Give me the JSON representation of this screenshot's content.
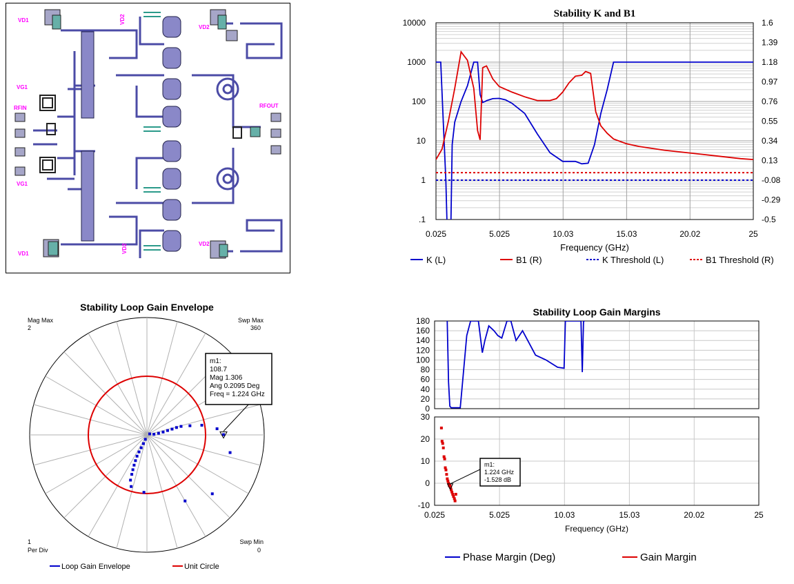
{
  "layout_panel": {
    "labels": {
      "vd1_top": "VD1",
      "vd2_top_mid": "VD2",
      "vd2_top_right": "VD2",
      "vg1_mid": "VG1",
      "rfin": "RFIN",
      "rfout": "RFOUT",
      "vg1_bot": "VG1",
      "vd1_bot": "VD1",
      "vd2_bot_mid": "VD2",
      "vd2_bot_right": "VD2"
    }
  },
  "colors": {
    "blue": "#0000cc",
    "red": "#dd0000",
    "grid": "#c8c8c8",
    "layout_bg": "#ffffff",
    "metal": "#5a5aa8",
    "label": "#ff00ff"
  },
  "chart_data": [
    {
      "type": "line",
      "title": "Stability K and B1",
      "xlabel": "Frequency (GHz)",
      "x_ticks": [
        "0.025",
        "5.025",
        "10.03",
        "15.03",
        "20.02",
        "25"
      ],
      "xlim": [
        0.025,
        25
      ],
      "y_left_ticks": [
        "10000",
        "1000",
        "100",
        "10",
        "1",
        ".1"
      ],
      "y_left_scale": "log",
      "ylim_left": [
        0.1,
        10000
      ],
      "y_right_ticks": [
        "1.6",
        "1.39",
        "1.18",
        "0.97",
        "0.76",
        "0.55",
        "0.34",
        "0.13",
        "-0.08",
        "-0.29",
        "-0.5"
      ],
      "ylim_right": [
        -0.5,
        1.6
      ],
      "grid": true,
      "legend_position": "bottom",
      "series": [
        {
          "name": "K (L)",
          "axis": "left",
          "color": "#0000cc",
          "dash": "solid",
          "x": [
            0.025,
            0.4,
            0.6,
            0.8,
            0.9,
            1.2,
            1.3,
            1.5,
            2,
            2.5,
            3,
            3.3,
            3.5,
            3.7,
            3.9,
            4,
            4.2,
            4.5,
            5,
            5.5,
            6,
            7,
            8,
            9,
            10,
            11,
            11.5,
            12,
            12.5,
            13,
            13.5,
            14,
            25
          ],
          "y": [
            1000,
            1000,
            30,
            1.0,
            0.07,
            0.07,
            8,
            30,
            100,
            250,
            1000,
            1000,
            150,
            95,
            100,
            105,
            110,
            118,
            120,
            110,
            90,
            50,
            15,
            5,
            3,
            3,
            2.6,
            2.7,
            8,
            50,
            200,
            1000,
            1000
          ]
        },
        {
          "name": "B1 (R)",
          "axis": "right",
          "color": "#dd0000",
          "dash": "solid",
          "x": [
            0.025,
            0.5,
            1,
            1.5,
            2,
            2.5,
            3,
            3.3,
            3.5,
            3.7,
            4,
            4.5,
            5,
            6,
            7,
            8,
            9,
            9.5,
            10,
            10.5,
            11,
            11.5,
            11.8,
            12.2,
            12.6,
            13,
            13.5,
            14,
            15,
            16,
            18,
            20,
            22,
            24,
            25
          ],
          "y": [
            0.14,
            0.25,
            0.55,
            0.9,
            1.29,
            1.2,
            0.9,
            0.45,
            0.35,
            1.12,
            1.14,
            1.0,
            0.92,
            0.86,
            0.81,
            0.77,
            0.77,
            0.79,
            0.86,
            0.96,
            1.03,
            1.04,
            1.08,
            1.06,
            0.65,
            0.5,
            0.42,
            0.36,
            0.31,
            0.28,
            0.24,
            0.21,
            0.18,
            0.15,
            0.14
          ]
        },
        {
          "name": "K Threshold (L)",
          "axis": "left",
          "color": "#0000cc",
          "dash": "dotted",
          "x": [
            0.025,
            25
          ],
          "y": [
            1,
            1
          ]
        },
        {
          "name": "B1 Threshold (R)",
          "axis": "right",
          "color": "#dd0000",
          "dash": "dotted",
          "x": [
            0.025,
            25
          ],
          "y": [
            0,
            0
          ]
        }
      ]
    },
    {
      "type": "scatter",
      "title": "Stability Loop Gain Envelope",
      "polar": true,
      "corner_labels": {
        "top_left_1": "Mag Max",
        "top_left_2": "2",
        "top_right_1": "Swp Max",
        "top_right_2": "360",
        "bottom_left_1": "1",
        "bottom_left_2": "Per Div",
        "bottom_right_1": "Swp Min",
        "bottom_right_2": "0"
      },
      "marker": {
        "name": "m1:",
        "line1": "108.7",
        "line2": "Mag 1.306",
        "line3": "Ang 0.2095 Deg",
        "line4": "Freq = 1.224 GHz"
      },
      "legend_position": "bottom",
      "series": [
        {
          "name": "Loop Gain Envelope",
          "color": "#0000cc",
          "points_mag_angdeg": [
            [
              0.05,
              20
            ],
            [
              0.12,
              5
            ],
            [
              0.2,
              8
            ],
            [
              0.28,
              10
            ],
            [
              0.36,
              12
            ],
            [
              0.44,
              13
            ],
            [
              0.52,
              14
            ],
            [
              0.6,
              14
            ],
            [
              0.75,
              12
            ],
            [
              0.95,
              10
            ],
            [
              1.2,
              5
            ],
            [
              1.306,
              0.2
            ],
            [
              1.45,
              -12
            ],
            [
              0.08,
              -110
            ],
            [
              0.16,
              -112
            ],
            [
              0.24,
              -114
            ],
            [
              0.32,
              -115
            ],
            [
              0.4,
              -115
            ],
            [
              0.48,
              -114
            ],
            [
              0.56,
              -113
            ],
            [
              0.64,
              -112
            ],
            [
              0.72,
              -111
            ],
            [
              0.82,
              -110
            ],
            [
              0.92,
              -107
            ],
            [
              0.98,
              -93
            ],
            [
              1.3,
              -60
            ],
            [
              1.5,
              -42
            ]
          ]
        },
        {
          "name": "Unit Circle",
          "color": "#dd0000",
          "radius_mag": 1
        }
      ]
    },
    {
      "type": "line",
      "title": "Stability Loop Gain Margins",
      "xlabel": "Frequency (GHz)",
      "x_ticks": [
        "0.025",
        "5.025",
        "10.03",
        "15.03",
        "20.02",
        "25"
      ],
      "xlim": [
        0.025,
        25
      ],
      "top_y_ticks": [
        "180",
        "160",
        "140",
        "120",
        "100",
        "80",
        "60",
        "40",
        "20",
        "0"
      ],
      "ylim_top": [
        0,
        180
      ],
      "bottom_y_ticks": [
        "30",
        "20",
        "10",
        "0",
        "-10"
      ],
      "ylim_bottom": [
        -10,
        30
      ],
      "marker": {
        "name": "m1:",
        "line1": "1.224 GHz",
        "line2": "-1.528 dB"
      },
      "legend_position": "bottom",
      "series": [
        {
          "name": "Phase Margin (Deg)",
          "color": "#0000cc",
          "panel": "top",
          "x": [
            1.0,
            1.1,
            1.2,
            1.3,
            1.6,
            1.8,
            2.0,
            2.2,
            2.5,
            2.8,
            3.0,
            3.4,
            3.7,
            3.9,
            4.2,
            4.6,
            4.9,
            5.2,
            5.6,
            5.9,
            6.3,
            6.8,
            7.2,
            7.8,
            8.6,
            9.5,
            10.0,
            10.1,
            10.2,
            11.3,
            11.4,
            11.5,
            11.6
          ],
          "y": [
            180,
            55,
            5,
            2,
            2,
            2,
            2,
            60,
            150,
            180,
            180,
            180,
            115,
            140,
            170,
            160,
            150,
            145,
            180,
            180,
            140,
            160,
            140,
            110,
            100,
            85,
            83,
            180,
            180,
            180,
            75,
            180,
            180
          ]
        },
        {
          "name": "Gain Margin",
          "color": "#dd0000",
          "panel": "bottom",
          "x": [
            0.55,
            0.6,
            0.65,
            0.7,
            0.75,
            0.8,
            0.85,
            0.9,
            0.95,
            1.0,
            1.05,
            1.1,
            1.15,
            1.2,
            1.224,
            1.26,
            1.3,
            1.36,
            1.42,
            1.48,
            1.55,
            1.6,
            1.66
          ],
          "y": [
            25,
            19,
            18,
            16,
            12,
            11,
            7,
            6,
            4,
            2,
            1,
            0,
            -1,
            -1,
            -1.528,
            -2,
            -3,
            -4,
            -5,
            -6,
            -7,
            -8,
            -5
          ]
        }
      ]
    }
  ]
}
